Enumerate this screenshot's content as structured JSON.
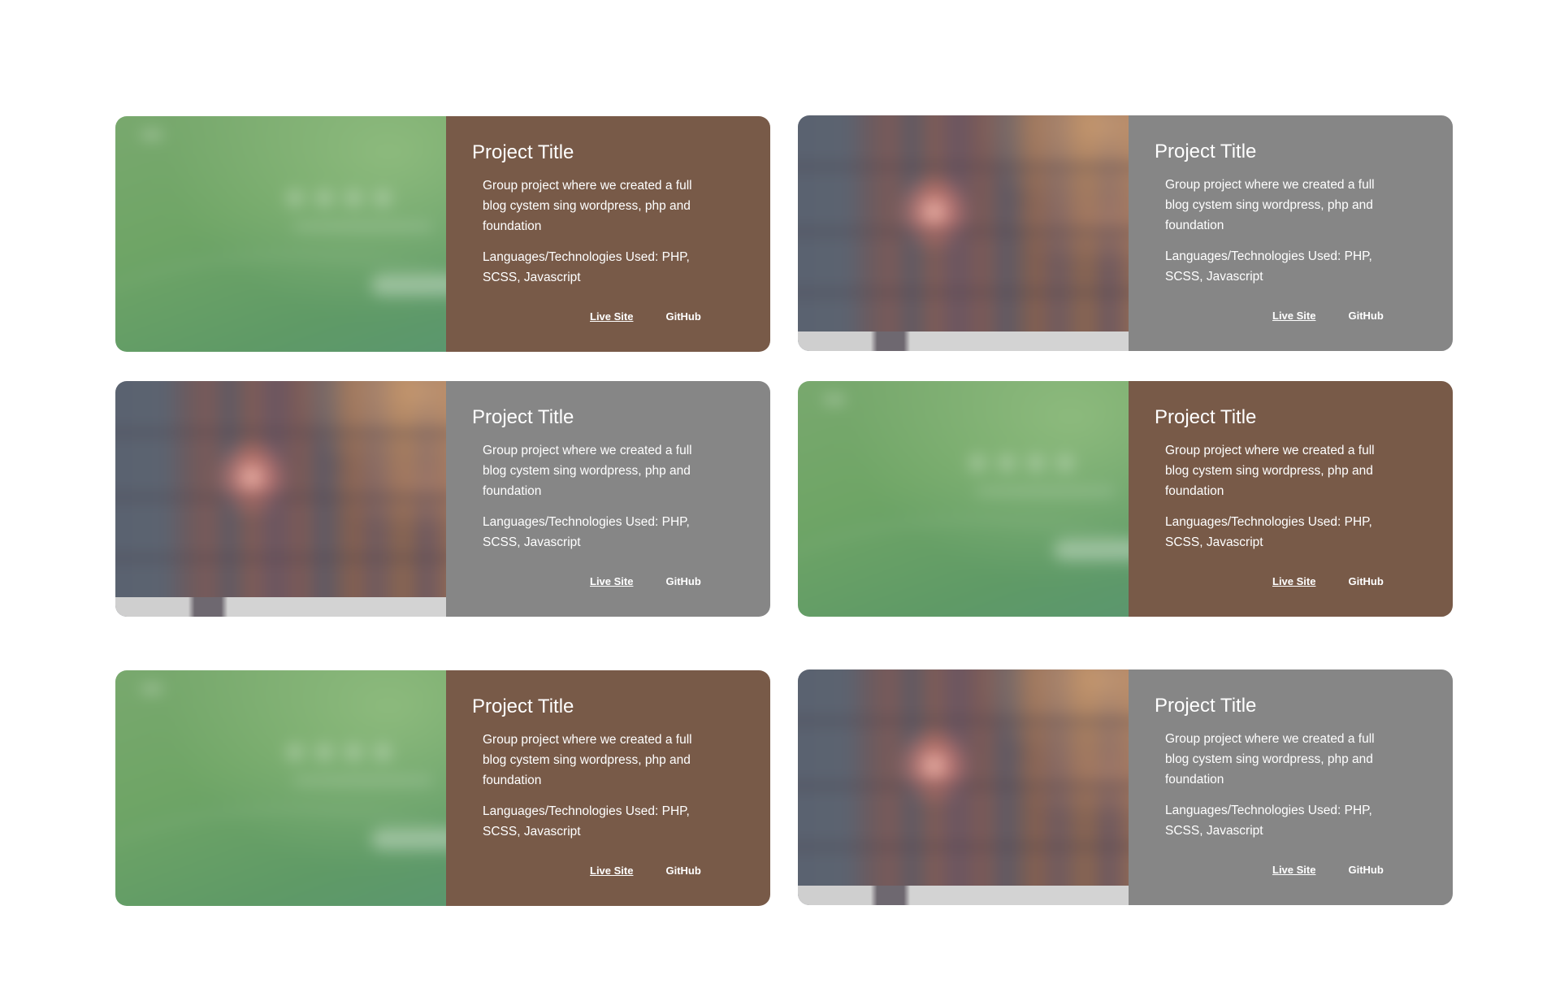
{
  "projects": [
    {
      "title": "Project Title",
      "description": "Group project where we created a full blog cystem sing wordpress, php and foundation",
      "technologies": "Languages/Technologies Used: PHP, SCSS, Javascript",
      "live_site_label": "Live Site",
      "github_label": "GitHub",
      "thumbnail": "green-site-preview",
      "panel_color": "#785a48"
    },
    {
      "title": "Project Title",
      "description": "Group project where we created a full blog cystem sing wordpress, php and foundation",
      "technologies": "Languages/Technologies Used: PHP, SCSS, Javascript",
      "live_site_label": "Live Site",
      "github_label": "GitHub",
      "thumbnail": "bookshelf-photo",
      "panel_color": "#868686"
    },
    {
      "title": "Project Title",
      "description": "Group project where we created a full blog cystem sing wordpress, php and foundation",
      "technologies": "Languages/Technologies Used: PHP, SCSS, Javascript",
      "live_site_label": "Live Site",
      "github_label": "GitHub",
      "thumbnail": "bookshelf-photo",
      "panel_color": "#868686"
    },
    {
      "title": "Project Title",
      "description": "Group project where we created a full blog cystem sing wordpress, php and foundation",
      "technologies": "Languages/Technologies Used: PHP, SCSS, Javascript",
      "live_site_label": "Live Site",
      "github_label": "GitHub",
      "thumbnail": "green-site-preview",
      "panel_color": "#785a48"
    },
    {
      "title": "Project Title",
      "description": "Group project where we created a full blog cystem sing wordpress, php and foundation",
      "technologies": "Languages/Technologies Used: PHP, SCSS, Javascript",
      "live_site_label": "Live Site",
      "github_label": "GitHub",
      "thumbnail": "green-site-preview",
      "panel_color": "#785a48"
    },
    {
      "title": "Project Title",
      "description": "Group project where we created a full blog cystem sing wordpress, php and foundation",
      "technologies": "Languages/Technologies Used: PHP, SCSS, Javascript",
      "live_site_label": "Live Site",
      "github_label": "GitHub",
      "thumbnail": "bookshelf-photo",
      "panel_color": "#868686"
    }
  ]
}
